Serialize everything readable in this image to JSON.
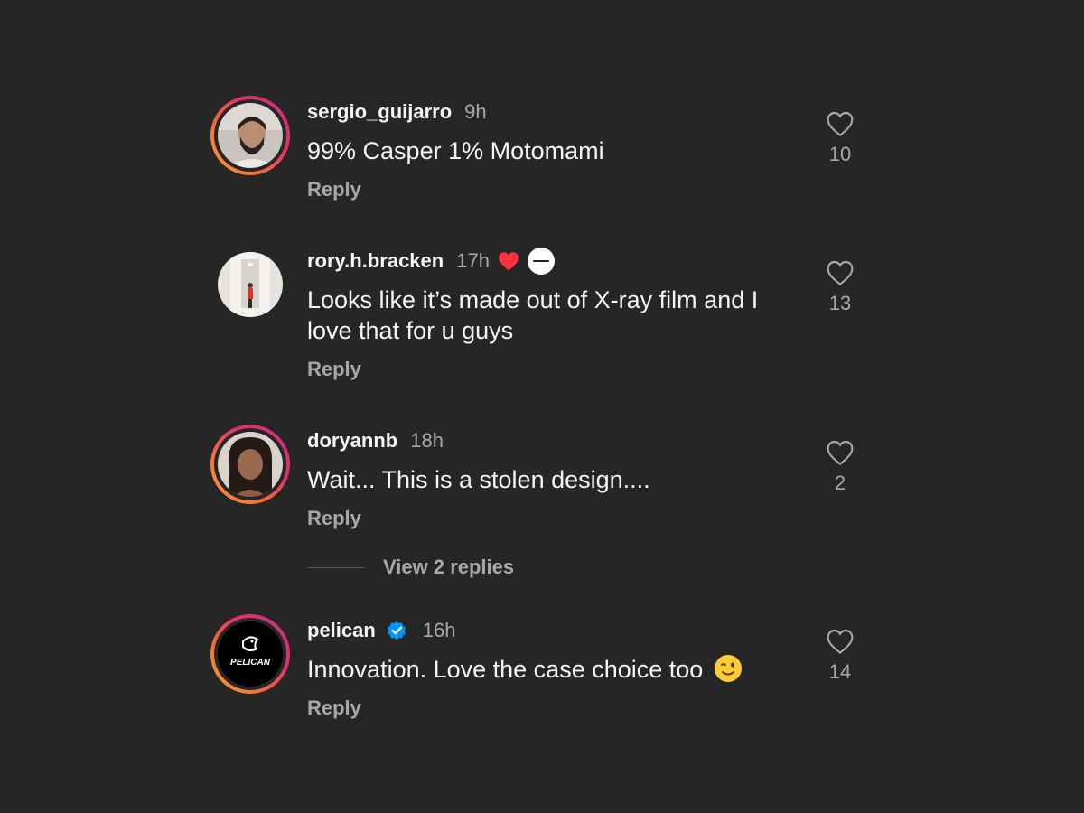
{
  "comments": [
    {
      "username": "sergio_guijarro",
      "time": "9h",
      "text": "99% Casper 1% Motomami",
      "reply_label": "Reply",
      "likes": "10",
      "story_ring": true
    },
    {
      "username": "rory.h.bracken",
      "time": "17h",
      "text": "Looks like it’s made out of X-ray film and I love that for u guys",
      "reply_label": "Reply",
      "likes": "13",
      "story_ring": false,
      "creator_liked": true
    },
    {
      "username": "doryannb",
      "time": "18h",
      "text": "Wait... This is a stolen design....",
      "reply_label": "Reply",
      "likes": "2",
      "story_ring": true,
      "view_replies_label": "View 2 replies"
    },
    {
      "username": "pelican",
      "time": "16h",
      "text": "Innovation. Love the case choice too",
      "reply_label": "Reply",
      "likes": "14",
      "story_ring": true,
      "verified": true,
      "avatar_logo_text": "PELICAN",
      "emoji": "winking-face"
    }
  ],
  "colors": {
    "background": "#262626",
    "text_primary": "#f5f5f5",
    "text_secondary": "#a8a8a8",
    "heart_red": "#ff3040",
    "verified_blue": "#0095f6"
  },
  "icons": [
    "heart-outline-icon",
    "heart-filled-icon",
    "verified-badge-icon",
    "winking-face-emoji"
  ]
}
